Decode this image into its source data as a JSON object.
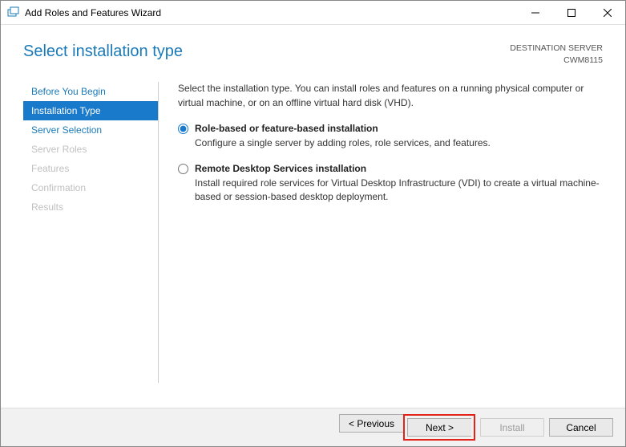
{
  "window": {
    "title": "Add Roles and Features Wizard"
  },
  "header": {
    "heading": "Select installation type",
    "destination_label": "DESTINATION SERVER",
    "server_name": "CWM8115"
  },
  "sidebar": {
    "items": [
      {
        "label": "Before You Begin",
        "state": "normal"
      },
      {
        "label": "Installation Type",
        "state": "selected"
      },
      {
        "label": "Server Selection",
        "state": "normal"
      },
      {
        "label": "Server Roles",
        "state": "disabled"
      },
      {
        "label": "Features",
        "state": "disabled"
      },
      {
        "label": "Confirmation",
        "state": "disabled"
      },
      {
        "label": "Results",
        "state": "disabled"
      }
    ]
  },
  "main": {
    "intro": "Select the installation type. You can install roles and features on a running physical computer or virtual machine, or on an offline virtual hard disk (VHD).",
    "options": [
      {
        "title": "Role-based or feature-based installation",
        "desc": "Configure a single server by adding roles, role services, and features.",
        "selected": true
      },
      {
        "title": "Remote Desktop Services installation",
        "desc": "Install required role services for Virtual Desktop Infrastructure (VDI) to create a virtual machine-based or session-based desktop deployment.",
        "selected": false
      }
    ]
  },
  "footer": {
    "previous": "< Previous",
    "next": "Next >",
    "install": "Install",
    "cancel": "Cancel"
  }
}
